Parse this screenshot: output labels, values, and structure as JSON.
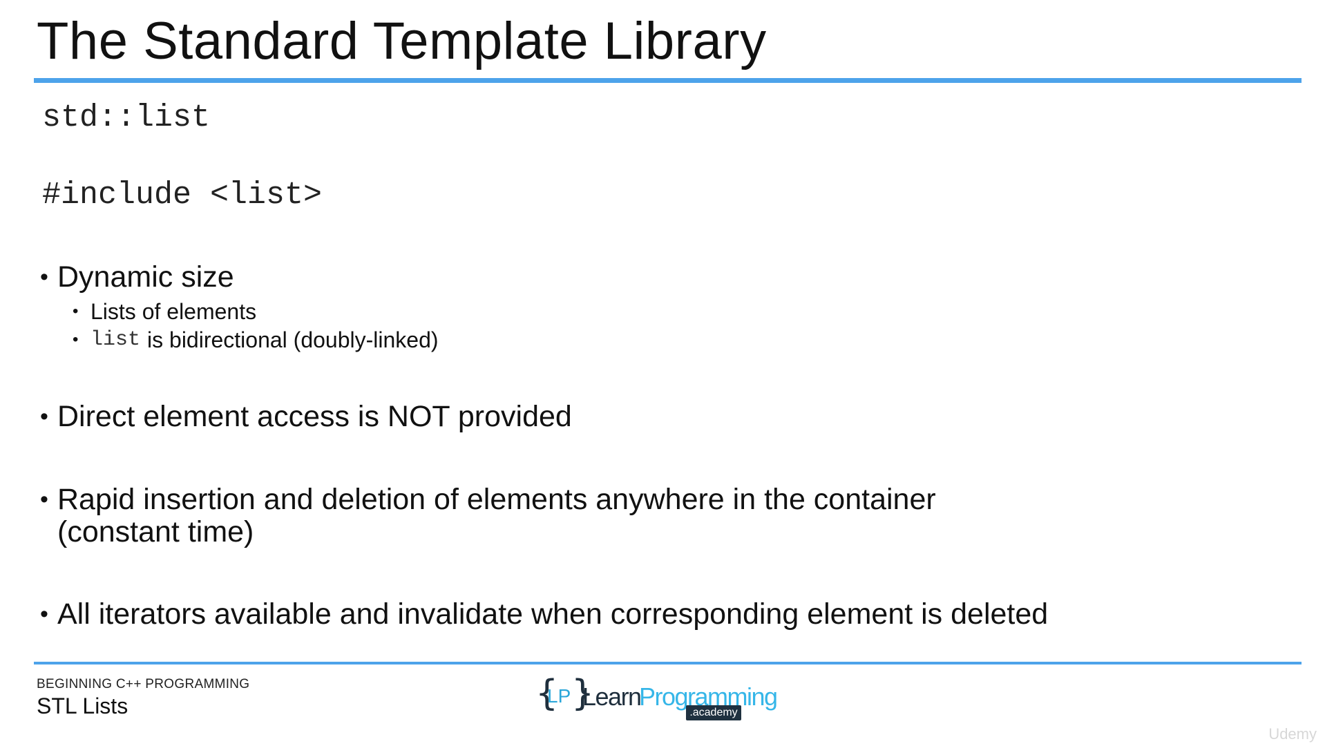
{
  "slide": {
    "title": "The Standard Template Library",
    "code_header": "std::list",
    "code_include": "#include <list>"
  },
  "bullets": [
    {
      "text": "Dynamic size",
      "sub": [
        {
          "prefix": "",
          "text": "Lists of elements"
        },
        {
          "prefix": "list",
          "text": "is bidirectional (doubly-linked)"
        }
      ]
    },
    {
      "text": "Direct element access is NOT provided"
    },
    {
      "text": "Rapid insertion and deletion of elements anywhere in the container (constant time)"
    },
    {
      "text": "All iterators available and invalidate when corresponding element is deleted"
    }
  ],
  "bullet_glyph": "•",
  "footer": {
    "course": "BEGINNING C++ PROGRAMMING",
    "topic": "STL Lists"
  },
  "logo": {
    "brace_left": "{",
    "brace_right": "}",
    "initials": "LP",
    "word1": "Learn",
    "word2": "Programming",
    "badge": ".academy"
  },
  "watermark": "Udemy",
  "colors": {
    "accent_rule": "#4da3ea",
    "logo_dark": "#1f2f3d",
    "logo_blue": "#36b6e8"
  }
}
